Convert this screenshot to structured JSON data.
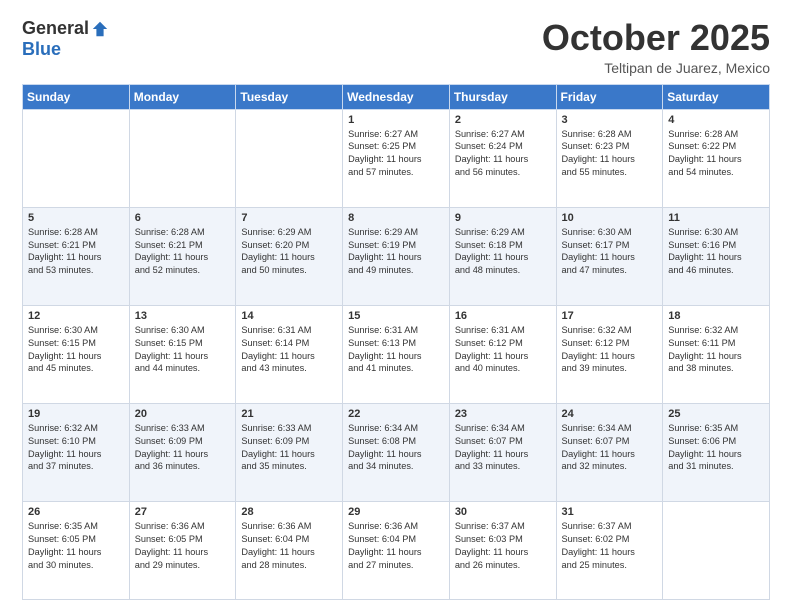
{
  "logo": {
    "general": "General",
    "blue": "Blue"
  },
  "header": {
    "month": "October 2025",
    "subtitle": "Teltipan de Juarez, Mexico"
  },
  "weekdays": [
    "Sunday",
    "Monday",
    "Tuesday",
    "Wednesday",
    "Thursday",
    "Friday",
    "Saturday"
  ],
  "weeks": [
    [
      {
        "day": "",
        "info": ""
      },
      {
        "day": "",
        "info": ""
      },
      {
        "day": "",
        "info": ""
      },
      {
        "day": "1",
        "info": "Sunrise: 6:27 AM\nSunset: 6:25 PM\nDaylight: 11 hours\nand 57 minutes."
      },
      {
        "day": "2",
        "info": "Sunrise: 6:27 AM\nSunset: 6:24 PM\nDaylight: 11 hours\nand 56 minutes."
      },
      {
        "day": "3",
        "info": "Sunrise: 6:28 AM\nSunset: 6:23 PM\nDaylight: 11 hours\nand 55 minutes."
      },
      {
        "day": "4",
        "info": "Sunrise: 6:28 AM\nSunset: 6:22 PM\nDaylight: 11 hours\nand 54 minutes."
      }
    ],
    [
      {
        "day": "5",
        "info": "Sunrise: 6:28 AM\nSunset: 6:21 PM\nDaylight: 11 hours\nand 53 minutes."
      },
      {
        "day": "6",
        "info": "Sunrise: 6:28 AM\nSunset: 6:21 PM\nDaylight: 11 hours\nand 52 minutes."
      },
      {
        "day": "7",
        "info": "Sunrise: 6:29 AM\nSunset: 6:20 PM\nDaylight: 11 hours\nand 50 minutes."
      },
      {
        "day": "8",
        "info": "Sunrise: 6:29 AM\nSunset: 6:19 PM\nDaylight: 11 hours\nand 49 minutes."
      },
      {
        "day": "9",
        "info": "Sunrise: 6:29 AM\nSunset: 6:18 PM\nDaylight: 11 hours\nand 48 minutes."
      },
      {
        "day": "10",
        "info": "Sunrise: 6:30 AM\nSunset: 6:17 PM\nDaylight: 11 hours\nand 47 minutes."
      },
      {
        "day": "11",
        "info": "Sunrise: 6:30 AM\nSunset: 6:16 PM\nDaylight: 11 hours\nand 46 minutes."
      }
    ],
    [
      {
        "day": "12",
        "info": "Sunrise: 6:30 AM\nSunset: 6:15 PM\nDaylight: 11 hours\nand 45 minutes."
      },
      {
        "day": "13",
        "info": "Sunrise: 6:30 AM\nSunset: 6:15 PM\nDaylight: 11 hours\nand 44 minutes."
      },
      {
        "day": "14",
        "info": "Sunrise: 6:31 AM\nSunset: 6:14 PM\nDaylight: 11 hours\nand 43 minutes."
      },
      {
        "day": "15",
        "info": "Sunrise: 6:31 AM\nSunset: 6:13 PM\nDaylight: 11 hours\nand 41 minutes."
      },
      {
        "day": "16",
        "info": "Sunrise: 6:31 AM\nSunset: 6:12 PM\nDaylight: 11 hours\nand 40 minutes."
      },
      {
        "day": "17",
        "info": "Sunrise: 6:32 AM\nSunset: 6:12 PM\nDaylight: 11 hours\nand 39 minutes."
      },
      {
        "day": "18",
        "info": "Sunrise: 6:32 AM\nSunset: 6:11 PM\nDaylight: 11 hours\nand 38 minutes."
      }
    ],
    [
      {
        "day": "19",
        "info": "Sunrise: 6:32 AM\nSunset: 6:10 PM\nDaylight: 11 hours\nand 37 minutes."
      },
      {
        "day": "20",
        "info": "Sunrise: 6:33 AM\nSunset: 6:09 PM\nDaylight: 11 hours\nand 36 minutes."
      },
      {
        "day": "21",
        "info": "Sunrise: 6:33 AM\nSunset: 6:09 PM\nDaylight: 11 hours\nand 35 minutes."
      },
      {
        "day": "22",
        "info": "Sunrise: 6:34 AM\nSunset: 6:08 PM\nDaylight: 11 hours\nand 34 minutes."
      },
      {
        "day": "23",
        "info": "Sunrise: 6:34 AM\nSunset: 6:07 PM\nDaylight: 11 hours\nand 33 minutes."
      },
      {
        "day": "24",
        "info": "Sunrise: 6:34 AM\nSunset: 6:07 PM\nDaylight: 11 hours\nand 32 minutes."
      },
      {
        "day": "25",
        "info": "Sunrise: 6:35 AM\nSunset: 6:06 PM\nDaylight: 11 hours\nand 31 minutes."
      }
    ],
    [
      {
        "day": "26",
        "info": "Sunrise: 6:35 AM\nSunset: 6:05 PM\nDaylight: 11 hours\nand 30 minutes."
      },
      {
        "day": "27",
        "info": "Sunrise: 6:36 AM\nSunset: 6:05 PM\nDaylight: 11 hours\nand 29 minutes."
      },
      {
        "day": "28",
        "info": "Sunrise: 6:36 AM\nSunset: 6:04 PM\nDaylight: 11 hours\nand 28 minutes."
      },
      {
        "day": "29",
        "info": "Sunrise: 6:36 AM\nSunset: 6:04 PM\nDaylight: 11 hours\nand 27 minutes."
      },
      {
        "day": "30",
        "info": "Sunrise: 6:37 AM\nSunset: 6:03 PM\nDaylight: 11 hours\nand 26 minutes."
      },
      {
        "day": "31",
        "info": "Sunrise: 6:37 AM\nSunset: 6:02 PM\nDaylight: 11 hours\nand 25 minutes."
      },
      {
        "day": "",
        "info": ""
      }
    ]
  ]
}
